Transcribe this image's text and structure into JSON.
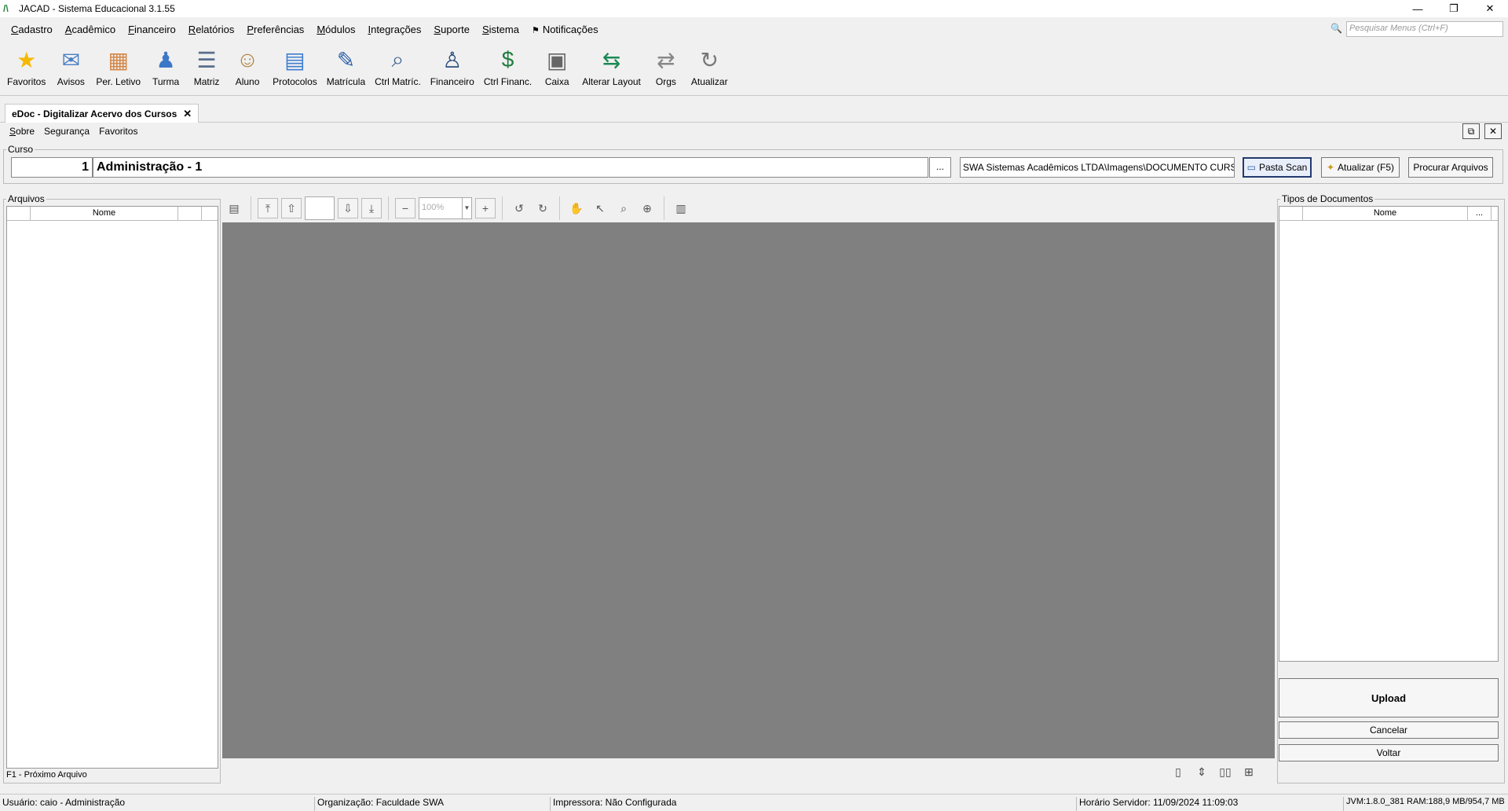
{
  "window": {
    "title": "JACAD - Sistema Educacional 3.1.55",
    "minimize": "—",
    "restore": "❐",
    "close": "✕"
  },
  "menu": {
    "items": [
      {
        "underline": "C",
        "rest": "adastro"
      },
      {
        "underline": "A",
        "rest": "cadêmico"
      },
      {
        "underline": "F",
        "rest": "inanceiro"
      },
      {
        "underline": "R",
        "rest": "elatórios"
      },
      {
        "underline": "P",
        "rest": "referências"
      },
      {
        "underline": "M",
        "rest": "ódulos"
      },
      {
        "underline": "I",
        "rest": "ntegrações"
      },
      {
        "underline": "S",
        "rest": "uporte"
      },
      {
        "underline": "S",
        "rest": "istema"
      }
    ],
    "notifications": "Notificações",
    "search_placeholder": "Pesquisar Menus (Ctrl+F)"
  },
  "toolbar": [
    {
      "label": "Favoritos",
      "icon": "★",
      "color": "#f5b800"
    },
    {
      "label": "Avisos",
      "icon": "✉",
      "color": "#4a7fc4"
    },
    {
      "label": "Per. Letivo",
      "icon": "▦",
      "color": "#d4884a"
    },
    {
      "label": "Turma",
      "icon": "♟",
      "color": "#3b78c8"
    },
    {
      "label": "Matriz",
      "icon": "☰",
      "color": "#5a6e8c"
    },
    {
      "label": "Aluno",
      "icon": "☺",
      "color": "#b0823c"
    },
    {
      "label": "Protocolos",
      "icon": "▤",
      "color": "#3d7dd0"
    },
    {
      "label": "Matrícula",
      "icon": "✎",
      "color": "#2b5ea8"
    },
    {
      "label": "Ctrl Matríc.",
      "icon": "⌕",
      "color": "#3e6592"
    },
    {
      "label": "Financeiro",
      "icon": "♙",
      "color": "#2b4f7c"
    },
    {
      "label": "Ctrl Financ.",
      "icon": "$",
      "color": "#1f7d3e"
    },
    {
      "label": "Caixa",
      "icon": "▣",
      "color": "#666666"
    },
    {
      "label": "Alterar Layout",
      "icon": "⇆",
      "color": "#1b8a55"
    },
    {
      "label": "Orgs",
      "icon": "⇄",
      "color": "#888888"
    },
    {
      "label": "Atualizar",
      "icon": "↻",
      "color": "#777777"
    }
  ],
  "tab": {
    "label": "eDoc - Digitalizar Acervo dos Cursos",
    "close": "✕"
  },
  "submenu": [
    {
      "underline": "S",
      "rest": "obre"
    },
    {
      "underline": "",
      "rest": "Segurança"
    },
    {
      "underline": "",
      "rest": "Favoritos"
    }
  ],
  "curso": {
    "group_title": "Curso",
    "code": "1",
    "name": "Administração - 1",
    "dots": "...",
    "path": "SWA Sistemas Acadêmicos LTDA\\Imagens\\DOCUMENTO CURSO",
    "btn_pasta": "Pasta Scan",
    "btn_atualizar": "Atualizar (F5)",
    "btn_procurar": "Procurar Arquivos"
  },
  "arquivos": {
    "group_title": "Arquivos",
    "col_nome": "Nome",
    "footer": "F1 - Próximo Arquivo"
  },
  "viewer": {
    "zoom": "100%",
    "page": ""
  },
  "tipos": {
    "group_title": "Tipos de Documentos",
    "col_nome": "Nome",
    "col_more": "...",
    "btn_upload": "Upload",
    "btn_cancelar": "Cancelar",
    "btn_voltar": "Voltar"
  },
  "status": {
    "usuario": "Usuário: caio - Administração",
    "organizacao": "Organização: Faculdade SWA",
    "impressora": "Impressora: Não Configurada",
    "horario": "Horário Servidor: 11/09/2024 11:09:03",
    "jvm": "JVM:1.8.0_381  RAM:188,9 MB/954,7 MB"
  }
}
